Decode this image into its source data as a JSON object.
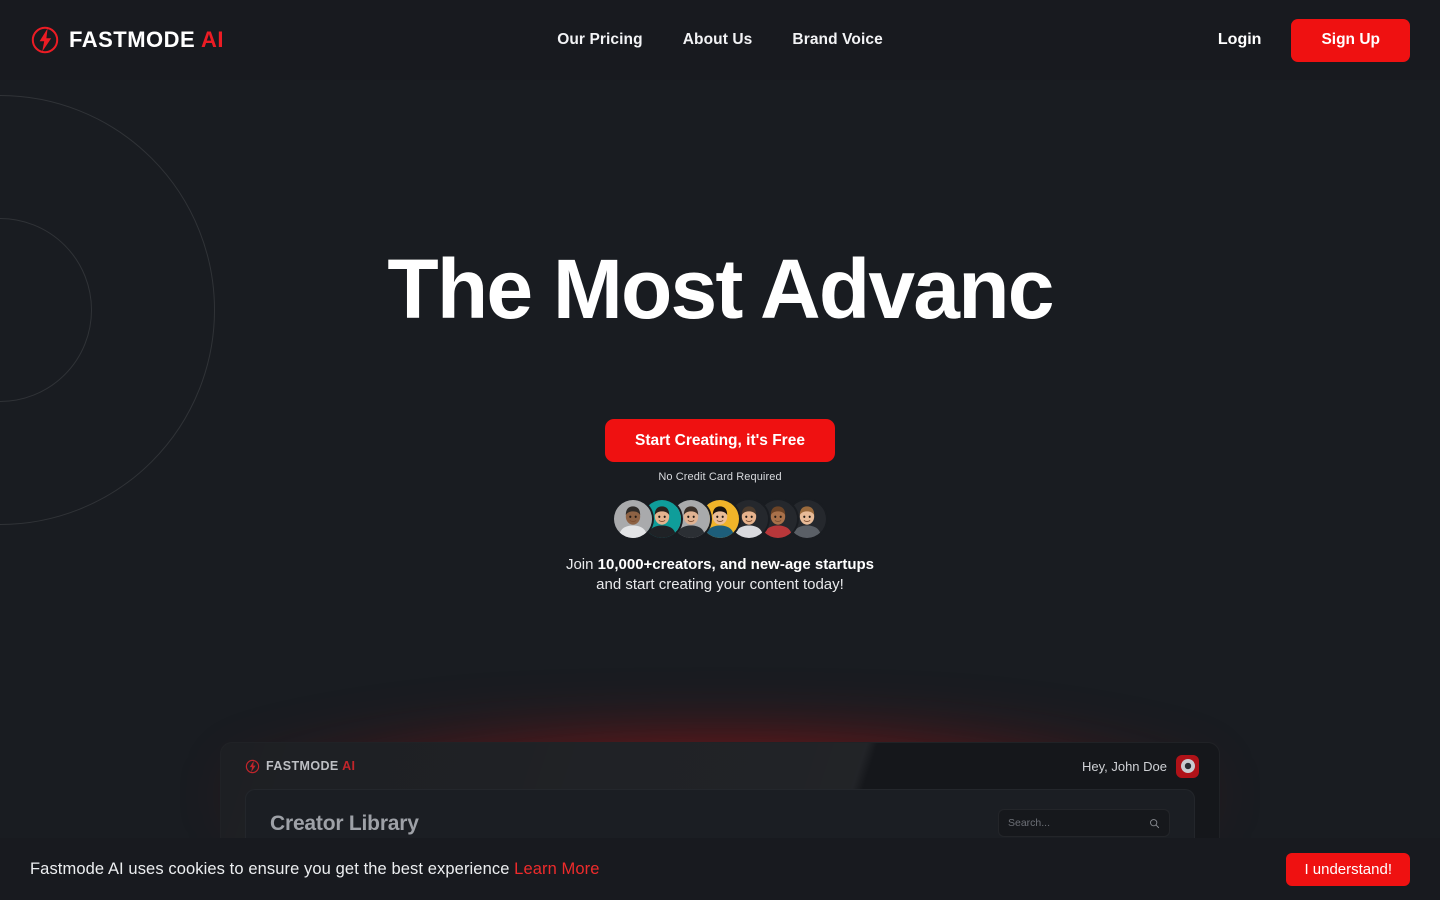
{
  "brand": {
    "name_main": "FASTMODE",
    "name_accent": "AI",
    "icon": "lightning-bolt-circle-icon",
    "accent_color": "#ec1c24"
  },
  "nav": {
    "items": [
      {
        "label": "Our Pricing"
      },
      {
        "label": "About Us"
      },
      {
        "label": "Brand Voice"
      }
    ],
    "login_label": "Login",
    "signup_label": "Sign Up"
  },
  "hero": {
    "headline": "The Most Advanc",
    "cta_label": "Start Creating, it's Free",
    "cta_note": "No Credit Card Required",
    "social_proof_prefix": "Join ",
    "social_proof_bold": "10,000+creators, and new-age startups",
    "social_proof_line2": "and start creating your content today!",
    "avatar_count": 7,
    "avatars": [
      {
        "name": "avatar-1",
        "bg": "#a9aaac",
        "skin": "#8d6244",
        "hair": "#2e2a27",
        "shirt": "#e3e4e6"
      },
      {
        "name": "avatar-2",
        "bg": "#0f9d9a",
        "skin": "#e5b48f",
        "hair": "#2a211c",
        "shirt": "#1f2226"
      },
      {
        "name": "avatar-3",
        "bg": "#a9aaac",
        "skin": "#e0b292",
        "hair": "#3a2f28",
        "shirt": "#2b2f34"
      },
      {
        "name": "avatar-4",
        "bg": "#f0b429",
        "skin": "#e9bd97",
        "hair": "#17130f",
        "shirt": "#1d5e7a"
      },
      {
        "name": "avatar-5",
        "bg": "#25282d",
        "skin": "#e7b38d",
        "hair": "#4a3a2c",
        "shirt": "#d9dade"
      },
      {
        "name": "avatar-6",
        "bg": "#25282d",
        "skin": "#a9714a",
        "hair": "#6b4326",
        "shirt": "#b8373a"
      },
      {
        "name": "avatar-7",
        "bg": "#25282d",
        "skin": "#e8bb98",
        "hair": "#9a6a3c",
        "shirt": "#5a5f66"
      }
    ]
  },
  "preview": {
    "brand_main": "FASTMODE",
    "brand_accent": "AI",
    "greeting": "Hey, John Doe",
    "page_title": "Creator Library",
    "search_placeholder": "Search...",
    "search_icon": "magnifier-icon"
  },
  "cookie": {
    "message": "Fastmode AI uses cookies to ensure you get the best experience ",
    "link_label": "Learn More",
    "accept_label": "I understand!"
  },
  "theme": {
    "page_bg": "#191c21",
    "header_bg": "#181a1f",
    "accent_red": "#ef1111",
    "glow_red": "#d71414"
  }
}
